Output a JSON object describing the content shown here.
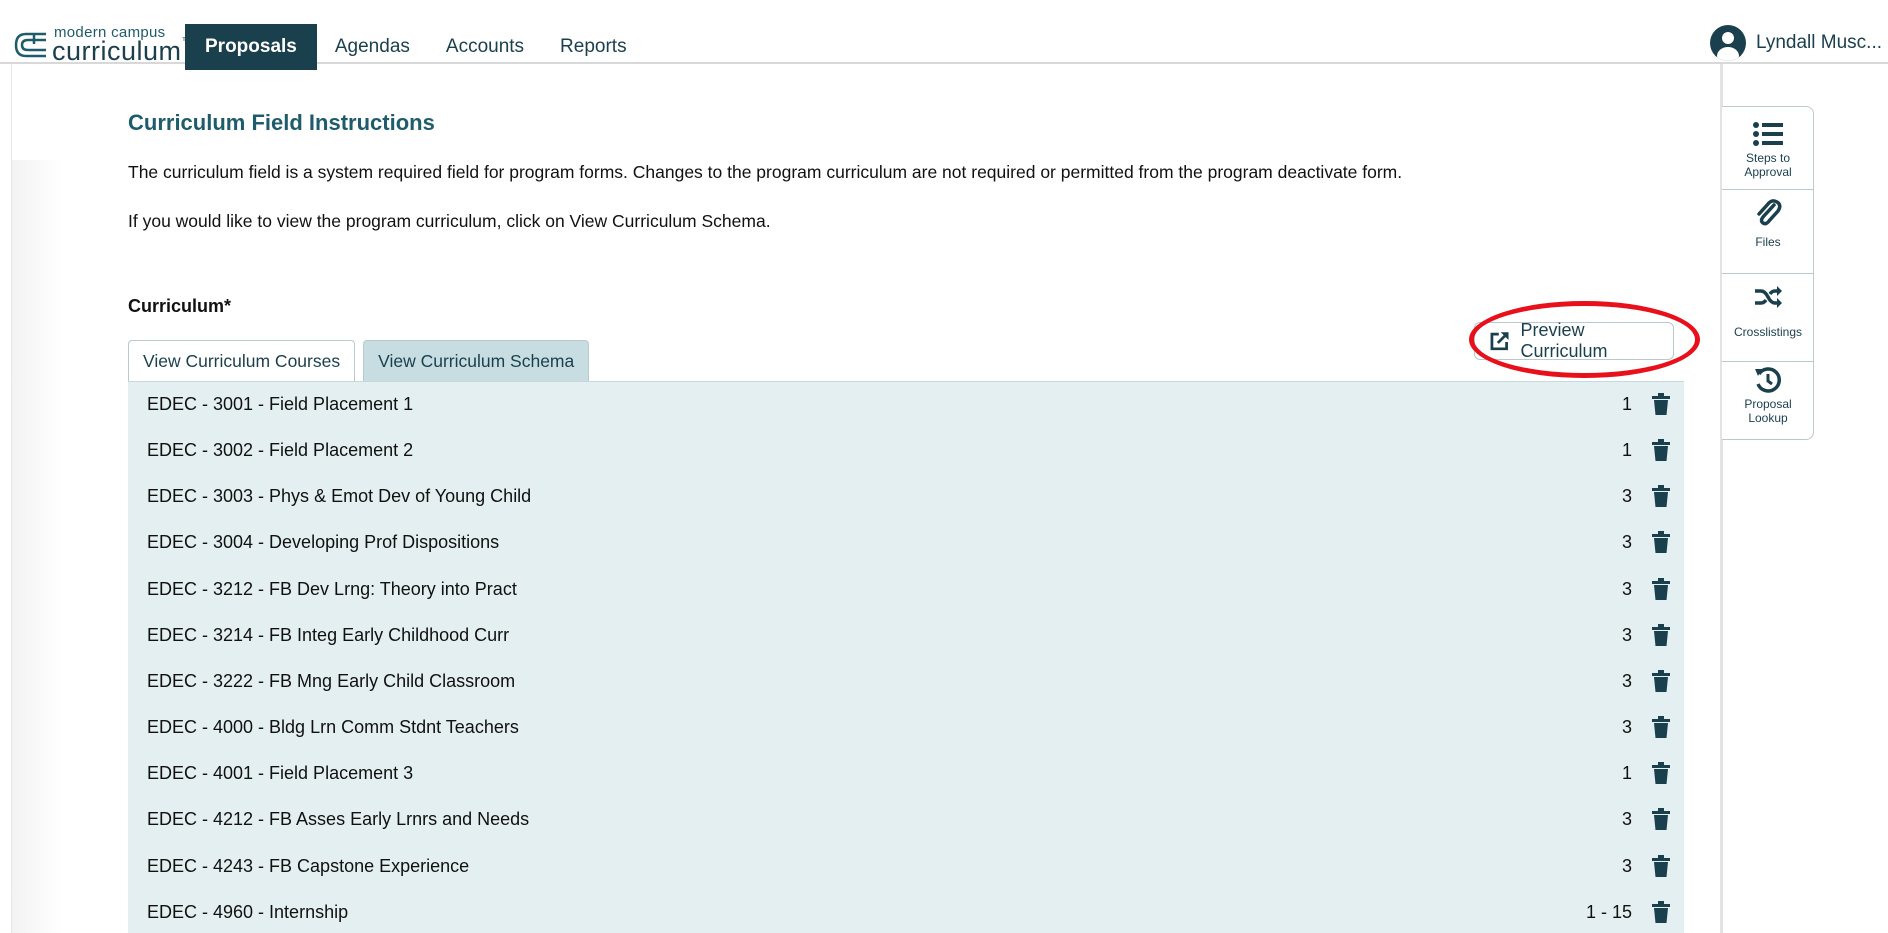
{
  "brand": {
    "line1": "modern campus",
    "line2": "curriculum",
    "tm": "™"
  },
  "nav": {
    "items": [
      {
        "label": "Proposals",
        "active": true
      },
      {
        "label": "Agendas",
        "active": false
      },
      {
        "label": "Accounts",
        "active": false
      },
      {
        "label": "Reports",
        "active": false
      }
    ]
  },
  "user": {
    "name": "Lyndall Musc..."
  },
  "side_panel": {
    "items": [
      {
        "label_line1": "Steps to",
        "label_line2": "Approval",
        "icon": "list-icon"
      },
      {
        "label_line1": "Files",
        "label_line2": "",
        "icon": "paperclip-icon"
      },
      {
        "label_line1": "Crosslistings",
        "label_line2": "",
        "icon": "shuffle-icon"
      },
      {
        "label_line1": "Proposal",
        "label_line2": "Lookup",
        "icon": "history-icon"
      }
    ]
  },
  "content": {
    "heading": "Curriculum Field Instructions",
    "para1": "The curriculum field is a system required field for program forms. Changes to the program curriculum are not required or permitted from the program deactivate form.",
    "para2": "If you would like to view the program curriculum, click on View Curriculum Schema.",
    "field_label": "Curriculum*",
    "preview_button": "Preview Curriculum",
    "tabs": [
      {
        "label": "View Curriculum Courses",
        "active": true
      },
      {
        "label": "View Curriculum Schema",
        "active": false
      }
    ]
  },
  "courses": [
    {
      "name": "EDEC - 3001 - Field Placement 1",
      "credits": "1"
    },
    {
      "name": "EDEC - 3002 - Field Placement 2",
      "credits": "1"
    },
    {
      "name": "EDEC - 3003 - Phys & Emot Dev of Young Child",
      "credits": "3"
    },
    {
      "name": "EDEC - 3004 - Developing Prof Dispositions",
      "credits": "3"
    },
    {
      "name": "EDEC - 3212 - FB Dev Lrng: Theory into Pract",
      "credits": "3"
    },
    {
      "name": "EDEC - 3214 - FB Integ Early Childhood Curr",
      "credits": "3"
    },
    {
      "name": "EDEC - 3222 - FB Mng Early Child Classroom",
      "credits": "3"
    },
    {
      "name": "EDEC - 4000 - Bldg Lrn Comm Stdnt Teachers",
      "credits": "3"
    },
    {
      "name": "EDEC - 4001 - Field Placement 3",
      "credits": "1"
    },
    {
      "name": "EDEC - 4212 - FB Asses Early Lrnrs and Needs",
      "credits": "3"
    },
    {
      "name": "EDEC - 4243 - FB Capstone Experience",
      "credits": "3"
    },
    {
      "name": "EDEC - 4960 - Internship",
      "credits": "1 - 15"
    }
  ],
  "colors": {
    "brand_dark": "#1a3f4d",
    "accent_teal": "#1f5c6b",
    "row_bg": "#e4eff1",
    "tab_inactive": "#c7dde1",
    "highlight": "#e8101a"
  }
}
